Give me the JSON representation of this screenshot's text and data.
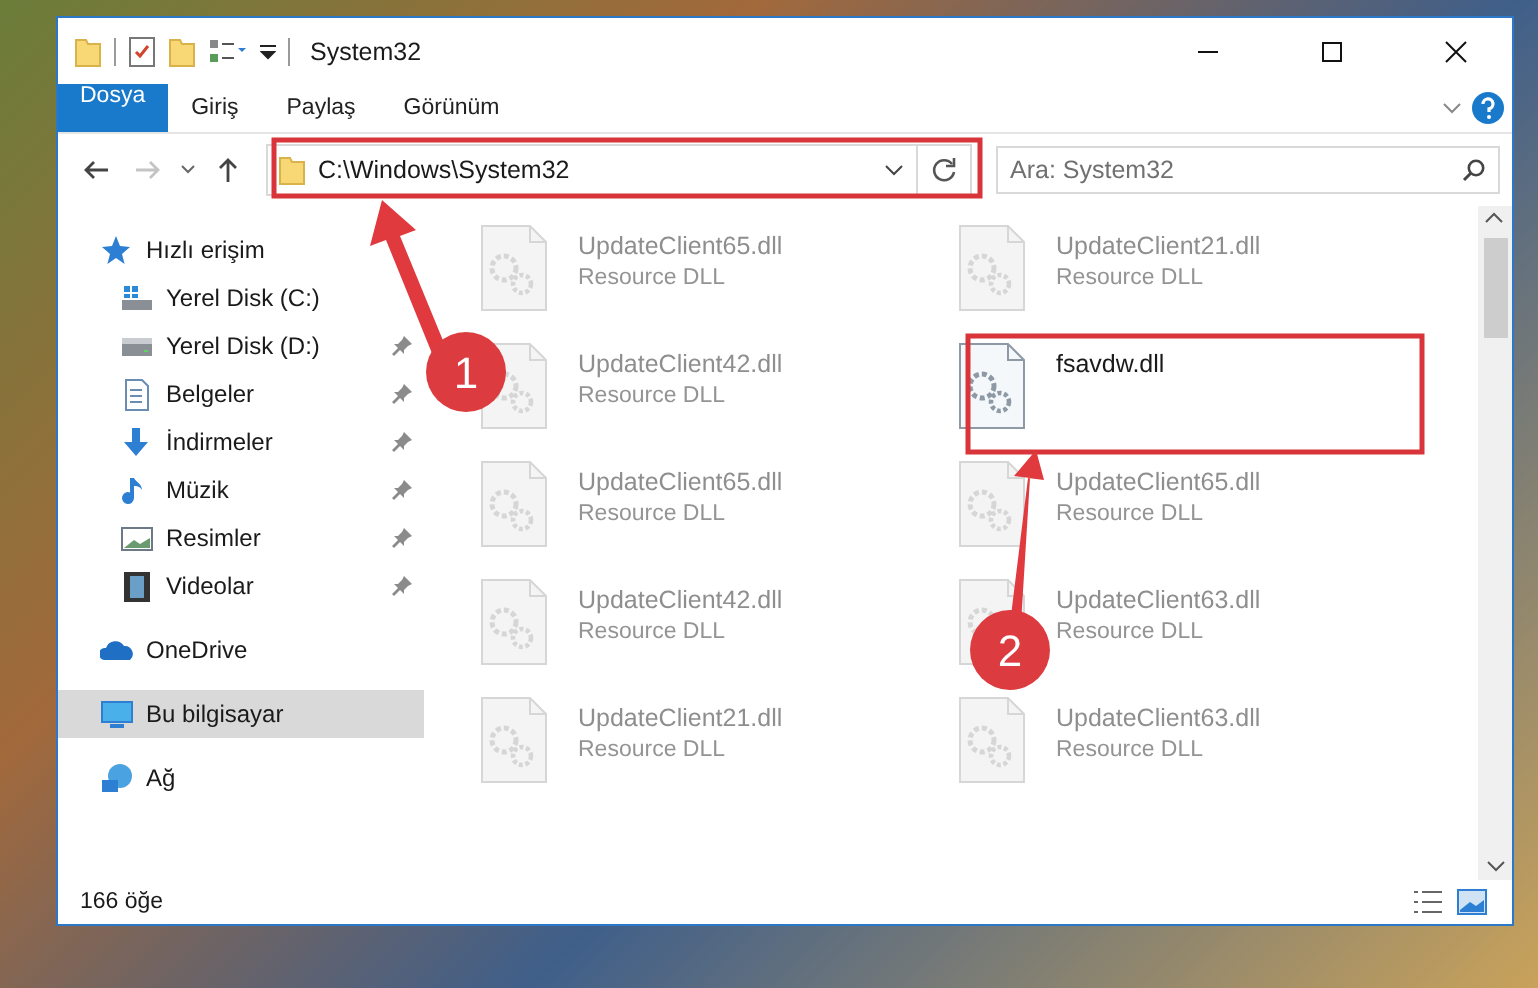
{
  "window": {
    "title": "System32"
  },
  "ribbon_tabs": [
    {
      "label": "Dosya",
      "kind": "file"
    },
    {
      "label": "Giriş",
      "kind": "tab"
    },
    {
      "label": "Paylaş",
      "kind": "tab"
    },
    {
      "label": "Görünüm",
      "kind": "tab"
    }
  ],
  "address_bar": {
    "path": "C:\\Windows\\System32"
  },
  "search": {
    "placeholder": "Ara: System32"
  },
  "sidebar": {
    "items": [
      {
        "label": "Hızlı erişim",
        "kind": "star",
        "selected": false,
        "children": [
          {
            "label": "Yerel Disk (C:)",
            "kind": "drive-windows",
            "pinned": false,
            "selected": false
          },
          {
            "label": "Yerel Disk (D:)",
            "kind": "drive",
            "pinned": true,
            "selected": false
          },
          {
            "label": "Belgeler",
            "kind": "documents",
            "pinned": true,
            "selected": false
          },
          {
            "label": "İndirmeler",
            "kind": "downloads",
            "pinned": true,
            "selected": false
          },
          {
            "label": "Müzik",
            "kind": "music",
            "pinned": true,
            "selected": false
          },
          {
            "label": "Resimler",
            "kind": "pictures",
            "pinned": true,
            "selected": false
          },
          {
            "label": "Videolar",
            "kind": "videos",
            "pinned": true,
            "selected": false
          }
        ]
      },
      {
        "label": "OneDrive",
        "kind": "cloud",
        "selected": false
      },
      {
        "label": "Bu bilgisayar",
        "kind": "computer",
        "selected": true
      },
      {
        "label": "Ağ",
        "kind": "network",
        "selected": false
      }
    ]
  },
  "files": [
    {
      "name": "UpdateClient65.dll",
      "type": "Resource DLL",
      "faded": true
    },
    {
      "name": "UpdateClient21.dll",
      "type": "Resource DLL",
      "faded": true
    },
    {
      "name": "UpdateClient42.dll",
      "type": "Resource DLL",
      "faded": true
    },
    {
      "name": "fsavdw.dll",
      "faded": false
    },
    {
      "name": "UpdateClient65.dll",
      "type": "Resource DLL",
      "faded": true
    },
    {
      "name": "UpdateClient65.dll",
      "type": "Resource DLL",
      "faded": true
    },
    {
      "name": "UpdateClient42.dll",
      "type": "Resource DLL",
      "faded": true
    },
    {
      "name": "UpdateClient63.dll",
      "type": "Resource DLL",
      "faded": true
    },
    {
      "name": "UpdateClient21.dll",
      "type": "Resource DLL",
      "faded": true
    },
    {
      "name": "UpdateClient63.dll",
      "type": "Resource DLL",
      "faded": true
    }
  ],
  "status_bar": {
    "item_count": "166 öğe"
  },
  "annotations": [
    {
      "label": "1"
    },
    {
      "label": "2"
    }
  ]
}
